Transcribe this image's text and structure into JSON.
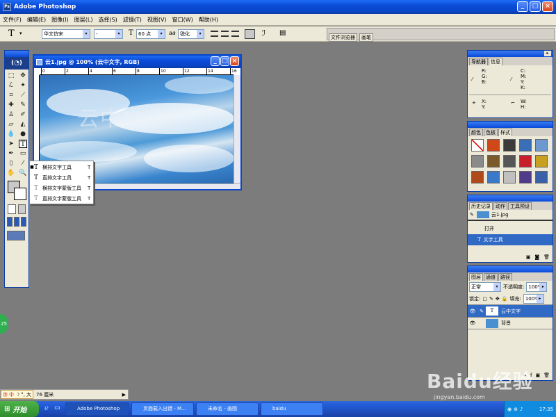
{
  "window": {
    "title": "Adobe Photoshop",
    "min": "_",
    "max": "□",
    "close": "×"
  },
  "menu": [
    "文件(F)",
    "编辑(E)",
    "图像(I)",
    "图层(L)",
    "选择(S)",
    "滤镜(T)",
    "视图(V)",
    "窗口(W)",
    "帮助(H)"
  ],
  "options": {
    "tool_glyph": "T",
    "font_family": "华文仿宋",
    "font_style": "-",
    "font_size": "60 点",
    "aa_label": "aa",
    "aa_mode": "锐化",
    "tab_browser": "文件浏览器",
    "tab_brush": "画笔"
  },
  "document": {
    "title": "云1.jpg @ 100% (云中文字, RGB)",
    "ruler_marks": [
      "0",
      "2",
      "4",
      "6",
      "8",
      "10",
      "12",
      "14",
      "16"
    ],
    "canvas_text": "云中文字",
    "sky_color": "#3a8fd6"
  },
  "flyout": {
    "items": [
      {
        "label": "横排文字工具",
        "key": "T"
      },
      {
        "label": "直排文字工具",
        "key": "T"
      },
      {
        "label": "横排文字蒙版工具",
        "key": "T"
      },
      {
        "label": "直排文字蒙版工具",
        "key": "T"
      }
    ]
  },
  "navigator": {
    "tabs": [
      "导航器",
      "信息"
    ],
    "rows": [
      {
        "left": "R:\nG:\nB:",
        "right": "C:\nM:\nY:\nK:"
      },
      {
        "left": "X:\nY:",
        "right": "W:\nH:"
      }
    ]
  },
  "swatches": {
    "tabs": [
      "颜色",
      "色板",
      "样式"
    ],
    "colors": [
      "#ffffff",
      "#d0471a",
      "#3b3b3b",
      "#3a6fb8",
      "#6c9ad0",
      "#8a8a8a",
      "#7a5a2a",
      "#555555",
      "#c8202a",
      "#c8a020",
      "#b04a1a",
      "#3a7ac8",
      "#c0c0c0",
      "#503a8a",
      "#3a60a8"
    ]
  },
  "history": {
    "tabs": [
      "历史记录",
      "动作",
      "工具预设"
    ],
    "snapshot": "云1.jpg",
    "items": [
      "打开",
      "文字工具"
    ]
  },
  "layers": {
    "tabs": [
      "图层",
      "通道",
      "路径"
    ],
    "blend_mode": "正常",
    "opacity_label": "不透明度:",
    "opacity": "100%",
    "lock_label": "锁定:",
    "fill_label": "填充:",
    "fill": "100%",
    "items": [
      {
        "name": "云中文字",
        "type": "T"
      },
      {
        "name": "背景",
        "type": "image"
      }
    ]
  },
  "statusbar": {
    "zoom": "100%",
    "info": "76 厘米",
    "ime": "中",
    "ime2": "大"
  },
  "taskbar": {
    "start": "开始",
    "items": [
      "Adobe Photoshop",
      "页面载入出错 - M...",
      "未命名 - 画图",
      "baidu"
    ],
    "time": "17:35"
  },
  "watermark": {
    "text": "Baidu经验",
    "url": "jingyan.baidu.com"
  },
  "side_badge": "25"
}
